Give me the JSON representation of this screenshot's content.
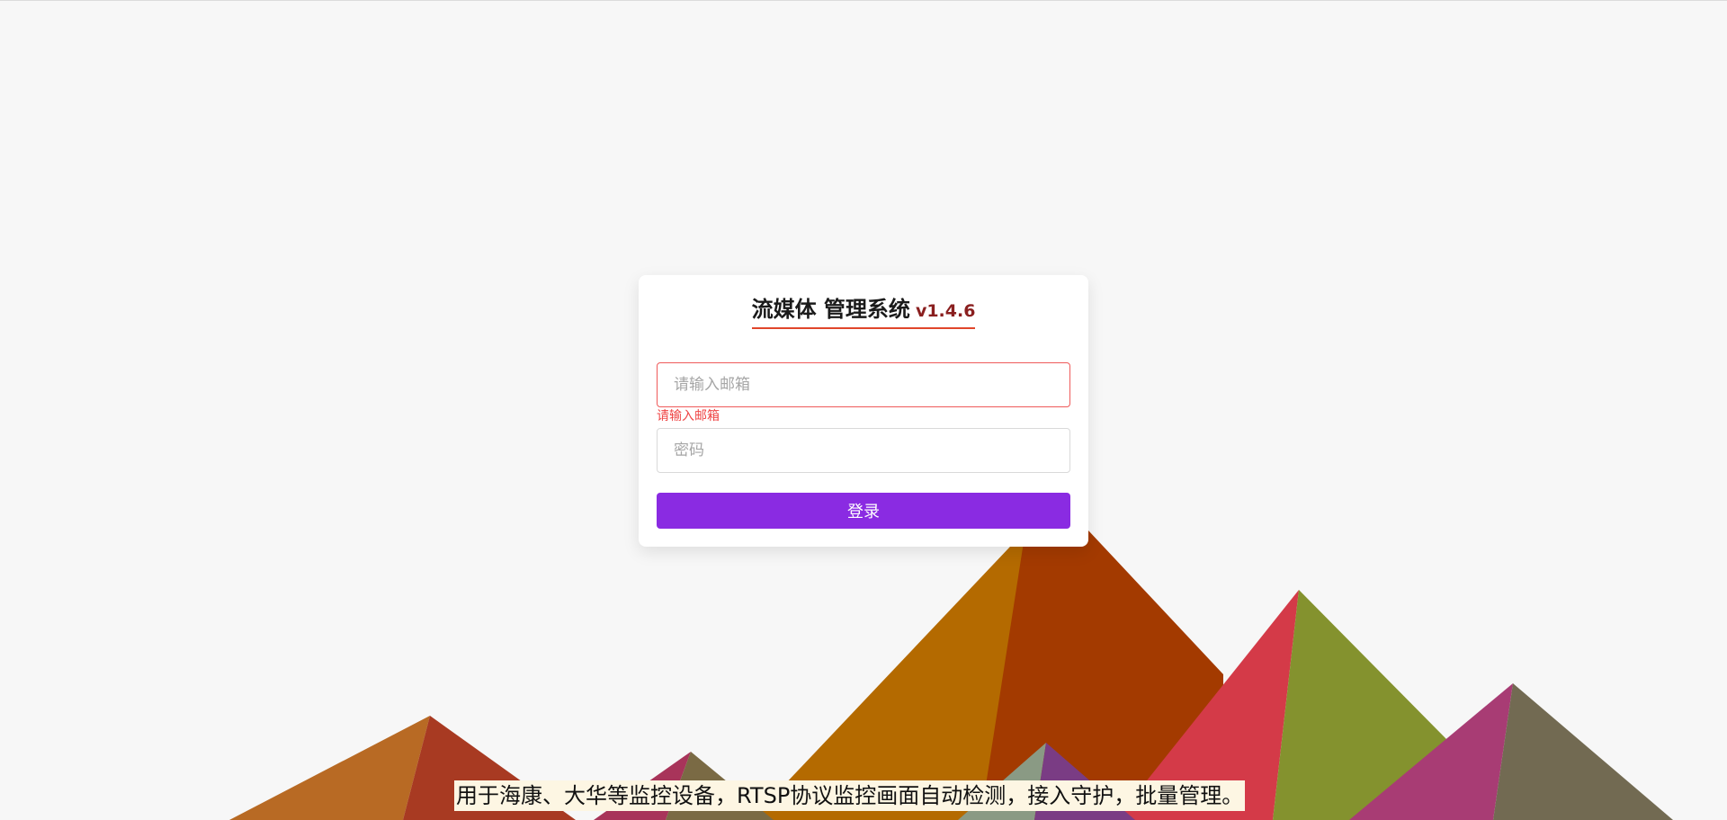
{
  "login": {
    "title": "流媒体 管理系统",
    "version": "v1.4.6",
    "email_placeholder": "请输入邮箱",
    "email_value": "",
    "email_error": "请输入邮箱",
    "password_placeholder": "密码",
    "password_value": "",
    "submit_label": "登录"
  },
  "footer": {
    "tagline": "用于海康、大华等监控设备，RTSP协议监控画面自动检测，接入守护，批量管理。"
  },
  "colors": {
    "background": "#f7f7f7",
    "accent": "#8a2be2",
    "error": "#ef4444",
    "title_underline": "#e0462b",
    "version": "#8a1f1f"
  }
}
